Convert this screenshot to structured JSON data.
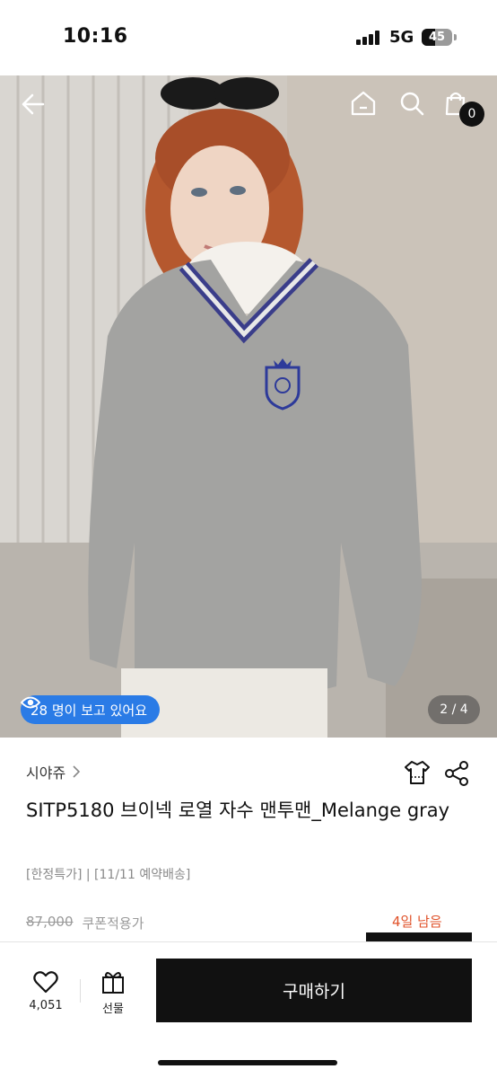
{
  "status_bar": {
    "time": "10:16",
    "network": "5G",
    "battery": "45",
    "battery_level": 0.45
  },
  "hero": {
    "viewers_text": "28 명이 보고 있어요",
    "page_counter": "2 / 4",
    "cart_count": "0",
    "icons": [
      "back-arrow-icon",
      "home-icon",
      "search-icon",
      "cart-icon",
      "eye-icon"
    ]
  },
  "product": {
    "brand": "시야쥬",
    "title": "SITP5180 브이넥 로열 자수 맨투맨_Melange gray",
    "tags": "[한정특가] | [11/11 예약배송]",
    "original_price": "87,000",
    "coupon_label": "쿠폰적용가",
    "days_left": "4일 남음"
  },
  "bottom_bar": {
    "like_count": "4,051",
    "gift_label": "선물",
    "buy_label": "구매하기"
  },
  "colors": {
    "accent_blue": "#2a7be6",
    "days_left_orange": "#e0522a",
    "buy_button": "#111111"
  }
}
